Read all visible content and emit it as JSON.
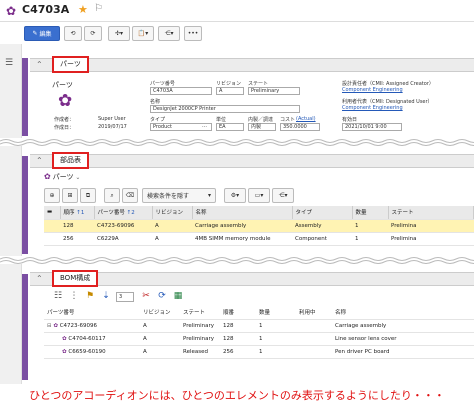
{
  "header": {
    "title": "C4703A",
    "edit_label": "編集"
  },
  "parts_section": {
    "title": "パーツ",
    "object_label": "パーツ",
    "created_by_label": "作成者：",
    "created_on_label": "作成日：",
    "created_by": "Super User",
    "created_on": "2019/07/17",
    "part_number_label": "パーツ番号",
    "part_number": "C4703A",
    "revision_label": "リビジョン",
    "revision": "A",
    "state_label": "ステート",
    "state": "Preliminary",
    "name_label": "名称",
    "name": "DesignJet 2000CP Printer",
    "type_label": "タイプ",
    "type": "Product",
    "unit_label": "単位",
    "unit": "EA",
    "make_buy_label": "内製／調達",
    "make_buy": "内製",
    "cost_label": "コスト",
    "cost_actual": "(Actual)",
    "cost": "350.0000",
    "design_owner_label": "設計責任者（CMII: Assigned Creator）",
    "design_owner": "Component Engineering",
    "user_owner_label": "利用者代表（CMII: Designated User）",
    "user_owner": "Component Engineering",
    "effective_date_label": "有効日",
    "effective_date": "2021/10/01 9:00"
  },
  "bom_section": {
    "title": "部品表",
    "dropdown_label": "パーツ",
    "search_placeholder": "検索条件を隠す",
    "columns": [
      "順序",
      "パーツ番号",
      "リビジョン",
      "名称",
      "タイプ",
      "数量",
      "ステート"
    ],
    "rows": [
      {
        "seq": "128",
        "number": "C4723-69096",
        "rev": "A",
        "name": "Carriage assembly",
        "type": "Assembly",
        "qty": "1",
        "state": "Prelimina"
      },
      {
        "seq": "256",
        "number": "C6229A",
        "rev": "A",
        "name": "4MB SIMM memory module",
        "type": "Component",
        "qty": "1",
        "state": "Prelimina"
      }
    ]
  },
  "bom_tree_section": {
    "title": "BOM構成",
    "depth_value": "3",
    "columns": [
      "パーツ番号",
      "リビジョン",
      "ステート",
      "順番",
      "数量",
      "利用中",
      "名称"
    ],
    "rows": [
      {
        "number": "C4723-69096",
        "rev": "A",
        "state": "Preliminary",
        "order": "128",
        "qty": "1",
        "name": "Carriage assembly"
      },
      {
        "number": "C4704-60117",
        "rev": "A",
        "state": "Preliminary",
        "order": "128",
        "qty": "1",
        "name": "Line sensor lens cover"
      },
      {
        "number": "C6659-60190",
        "rev": "A",
        "state": "Released",
        "order": "256",
        "qty": "1",
        "name": "Pen driver PC board"
      }
    ]
  },
  "caption": "ひとつのアコーディオンには、ひとつのエレメントのみ表示するようにしたり・・・",
  "colors": {
    "accent": "#7b4fa3",
    "highlight": "#fff3b3",
    "caption": "#e01010",
    "primary": "#3a6fcf"
  }
}
